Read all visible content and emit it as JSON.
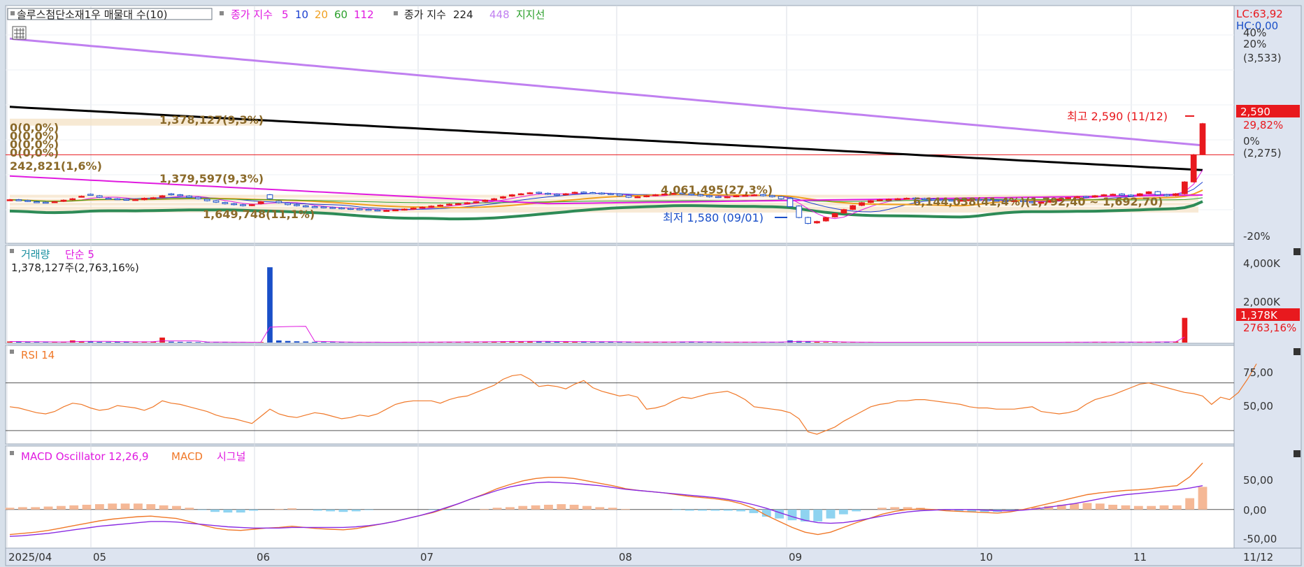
{
  "colors": {
    "bg": "#ffffff",
    "axis_bg": "#dde4f0",
    "up": "#e8191e",
    "down": "#1a4fc8",
    "ma5": "#e01ae0",
    "ma10": "#1a3fd0",
    "ma20": "#f0a020",
    "ma60": "#2ca02c",
    "ma112": "#e01ae0",
    "ma224": "#000000",
    "ma448": "#c080f0",
    "support": "#2e8b57",
    "band": "#f5e3c8",
    "rsi": "#f07828",
    "macd": "#f07828",
    "signal": "#8a2be2",
    "osc_pos": "#f5b896",
    "osc_neg": "#8fd3f0",
    "vol_ma": "#e01ae0",
    "annot": "#8b6a2a"
  },
  "price_panel": {
    "legend": {
      "stock_title": "솔루스첨단소재1우 매물대 수(10)",
      "close_index": "종가 지수",
      "ma_short": [
        "5",
        "10",
        "20",
        "60",
        "112"
      ],
      "close_index_2": "종가 지수",
      "ma_long": [
        "224",
        "448"
      ],
      "support_label": "지지선"
    },
    "lc_label": "LC:63,92",
    "hc_label": "HC:0,00",
    "right_axis_labels": [
      "40%",
      "20%",
      "(3,533)",
      "0%",
      "(2,275)",
      "-20%"
    ],
    "price_tag": "2,590",
    "pct_tag": "29,82%",
    "high_annotation": "최고 2,590 (11/12)",
    "low_annotation": "최저 1,580 (09/01)",
    "volume_profile_labels": [
      "1,378,127(9,3%)",
      "0(0,0%)",
      "0(0,0%)",
      "0(0,0%)",
      "0(0,0%)",
      "242,821(1,6%)",
      "1,379,597(9,3%)",
      "1,649,748(11,1%)",
      "4,061,495(27,3%)",
      "6,144,038(41,4%)(1,792,40 ~ 1,692,70)"
    ]
  },
  "volume_panel": {
    "title": "거래량",
    "ma_label": "단순 5",
    "info": "1,378,127주(2,763,16%)",
    "axis_labels": [
      "4,000K",
      "2,000K"
    ],
    "tag": "1,378K",
    "tag2": "2763,16%"
  },
  "rsi_panel": {
    "title": "RSI 14",
    "axis_labels": [
      "75,00",
      "50,00"
    ]
  },
  "macd_panel": {
    "title": "MACD Oscillator 12,26,9",
    "macd_label": "MACD",
    "signal_label": "시그널",
    "axis_labels": [
      "50,00",
      "0,00",
      "-50,00"
    ]
  },
  "x_axis": {
    "labels": [
      "2025/04",
      "05",
      "06",
      "07",
      "08",
      "09",
      "10",
      "11"
    ],
    "right_label": "11/12"
  },
  "chart_data": {
    "type": "candlestick",
    "price_ylim": [
      1400,
      3700
    ],
    "months": [
      "2025/04",
      "05",
      "06",
      "07",
      "08",
      "09",
      "10",
      "11"
    ],
    "close": [
      1820,
      1815,
      1805,
      1795,
      1790,
      1800,
      1815,
      1830,
      1855,
      1870,
      1845,
      1830,
      1825,
      1820,
      1822,
      1835,
      1840,
      1860,
      1870,
      1860,
      1845,
      1830,
      1810,
      1795,
      1780,
      1770,
      1760,
      1770,
      1800,
      1830,
      1790,
      1770,
      1760,
      1750,
      1745,
      1740,
      1735,
      1730,
      1725,
      1720,
      1715,
      1710,
      1712,
      1718,
      1725,
      1735,
      1745,
      1755,
      1765,
      1775,
      1780,
      1790,
      1800,
      1815,
      1830,
      1850,
      1870,
      1880,
      1890,
      1885,
      1875,
      1870,
      1880,
      1895,
      1890,
      1885,
      1880,
      1875,
      1860,
      1845,
      1850,
      1860,
      1870,
      1878,
      1885,
      1880,
      1870,
      1860,
      1850,
      1845,
      1850,
      1860,
      1865,
      1870,
      1860,
      1850,
      1830,
      1750,
      1640,
      1580,
      1600,
      1640,
      1680,
      1720,
      1760,
      1790,
      1810,
      1820,
      1825,
      1830,
      1835,
      1830,
      1825,
      1820,
      1815,
      1810,
      1815,
      1820,
      1818,
      1812,
      1808,
      1805,
      1810,
      1800,
      1790,
      1795,
      1810,
      1830,
      1840,
      1850,
      1845,
      1860,
      1870,
      1875,
      1865,
      1860,
      1880,
      1900,
      1870,
      1860,
      1880,
      2000,
      2275,
      2590
    ],
    "open": [
      1815,
      1820,
      1812,
      1800,
      1795,
      1795,
      1805,
      1820,
      1850,
      1875,
      1860,
      1835,
      1830,
      1825,
      1818,
      1820,
      1835,
      1845,
      1880,
      1870,
      1858,
      1845,
      1825,
      1810,
      1792,
      1780,
      1770,
      1762,
      1780,
      1870,
      1805,
      1785,
      1770,
      1758,
      1750,
      1748,
      1742,
      1738,
      1732,
      1728,
      1722,
      1716,
      1708,
      1712,
      1718,
      1726,
      1738,
      1748,
      1758,
      1768,
      1776,
      1782,
      1792,
      1802,
      1818,
      1836,
      1856,
      1872,
      1882,
      1895,
      1885,
      1876,
      1872,
      1884,
      1897,
      1892,
      1888,
      1882,
      1876,
      1862,
      1845,
      1852,
      1862,
      1872,
      1880,
      1888,
      1882,
      1872,
      1862,
      1852,
      1842,
      1852,
      1862,
      1866,
      1872,
      1862,
      1852,
      1832,
      1756,
      1640,
      1585,
      1605,
      1645,
      1685,
      1722,
      1762,
      1792,
      1812,
      1822,
      1827,
      1832,
      1837,
      1832,
      1827,
      1822,
      1817,
      1808,
      1815,
      1822,
      1820,
      1814,
      1810,
      1803,
      1812,
      1802,
      1785,
      1795,
      1812,
      1832,
      1842,
      1852,
      1847,
      1862,
      1872,
      1878,
      1867,
      1862,
      1882,
      1902,
      1872,
      1862,
      1880,
      2000,
      2280
    ],
    "volume_k": [
      60,
      55,
      40,
      35,
      30,
      30,
      45,
      120,
      80,
      60,
      40,
      35,
      50,
      45,
      40,
      35,
      60,
      280,
      50,
      40,
      35,
      30,
      25,
      20,
      20,
      20,
      25,
      20,
      30,
      4200,
      120,
      90,
      70,
      60,
      40,
      30,
      30,
      25,
      20,
      20,
      20,
      25,
      20,
      20,
      25,
      30,
      30,
      35,
      40,
      35,
      40,
      40,
      45,
      50,
      60,
      70,
      80,
      60,
      70,
      60,
      55,
      50,
      55,
      60,
      50,
      45,
      40,
      40,
      35,
      30,
      30,
      35,
      40,
      35,
      40,
      50,
      40,
      35,
      30,
      30,
      25,
      25,
      30,
      35,
      30,
      30,
      40,
      120,
      90,
      60,
      40,
      30,
      25,
      25,
      20,
      20,
      20,
      20,
      20,
      20,
      20,
      20,
      20,
      20,
      20,
      20,
      20,
      20,
      20,
      20,
      20,
      20,
      20,
      20,
      20,
      20,
      20,
      25,
      30,
      25,
      25,
      30,
      30,
      30,
      25,
      30,
      35,
      40,
      40,
      45,
      60,
      1378
    ],
    "rsi": [
      50,
      49,
      47,
      45,
      44,
      46,
      50,
      53,
      52,
      49,
      47,
      48,
      51,
      50,
      49,
      47,
      50,
      55,
      53,
      52,
      50,
      48,
      46,
      43,
      41,
      40,
      38,
      36,
      42,
      48,
      44,
      42,
      41,
      43,
      45,
      44,
      42,
      40,
      41,
      43,
      42,
      44,
      48,
      52,
      54,
      55,
      55,
      55,
      53,
      56,
      58,
      59,
      62,
      65,
      68,
      73,
      76,
      77,
      73,
      67,
      68,
      67,
      65,
      69,
      72,
      66,
      63,
      61,
      59,
      60,
      58,
      48,
      49,
      51,
      55,
      58,
      57,
      59,
      61,
      62,
      63,
      60,
      56,
      50,
      49,
      48,
      47,
      45,
      40,
      29,
      27,
      30,
      33,
      38,
      42,
      46,
      50,
      52,
      53,
      55,
      55,
      56,
      56,
      55,
      54,
      53,
      52,
      50,
      49,
      49,
      48,
      48,
      48,
      49,
      50,
      46,
      45,
      44,
      45,
      47,
      52,
      56,
      58,
      60,
      63,
      66,
      69,
      70,
      68,
      66,
      64,
      62,
      61,
      59,
      52,
      58,
      56,
      62,
      73,
      86
    ],
    "macd": [
      -42,
      -40,
      -38,
      -35,
      -31,
      -27,
      -23,
      -19,
      -16,
      -14,
      -12,
      -11,
      -13,
      -15,
      -20,
      -26,
      -31,
      -34,
      -35,
      -33,
      -31,
      -30,
      -28,
      -30,
      -32,
      -33,
      -34,
      -32,
      -28,
      -24,
      -20,
      -15,
      -10,
      -5,
      2,
      10,
      18,
      26,
      35,
      42,
      48,
      52,
      54,
      54,
      52,
      48,
      44,
      40,
      35,
      32,
      30,
      28,
      25,
      22,
      20,
      18,
      15,
      10,
      2,
      -10,
      -20,
      -30,
      -38,
      -42,
      -38,
      -30,
      -22,
      -15,
      -8,
      -3,
      0,
      1,
      0,
      -2,
      -3,
      -4,
      -5,
      -6,
      -4,
      0,
      5,
      10,
      15,
      20,
      25,
      28,
      30,
      32,
      33,
      35,
      38,
      40,
      55,
      78
    ],
    "signal": [
      -45,
      -44,
      -42,
      -40,
      -37,
      -34,
      -31,
      -28,
      -26,
      -24,
      -22,
      -20,
      -20,
      -21,
      -23,
      -25,
      -27,
      -29,
      -30,
      -31,
      -31,
      -31,
      -30,
      -30,
      -30,
      -30,
      -30,
      -29,
      -27,
      -24,
      -20,
      -15,
      -10,
      -4,
      3,
      10,
      18,
      25,
      32,
      38,
      42,
      45,
      46,
      45,
      44,
      42,
      40,
      37,
      34,
      32,
      30,
      28,
      26,
      24,
      22,
      20,
      17,
      13,
      8,
      2,
      -5,
      -12,
      -18,
      -22,
      -23,
      -22,
      -19,
      -15,
      -11,
      -7,
      -4,
      -2,
      -1,
      0,
      0,
      0,
      -1,
      -2,
      -2,
      -1,
      1,
      4,
      7,
      10,
      14,
      18,
      22,
      25,
      27,
      29,
      31,
      33,
      36,
      40
    ]
  }
}
